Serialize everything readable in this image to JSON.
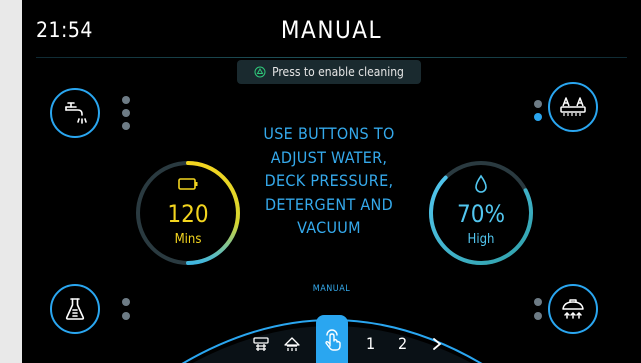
{
  "status": {
    "time": "21:54",
    "mode_title": "MANUAL"
  },
  "banner": {
    "text": "Press to enable cleaning",
    "icon": "recycle-icon"
  },
  "instructions": [
    "USE BUTTONS TO",
    "ADJUST WATER,",
    "DECK PRESSURE,",
    "DETERGENT AND",
    "VACUUM"
  ],
  "controls": {
    "water": {
      "icon": "faucet-icon",
      "level_dots": 3,
      "active_dots": 0
    },
    "deck_pressure": {
      "icon": "brush-deck-icon",
      "level_dots": 2,
      "active_dots": 1
    },
    "detergent": {
      "icon": "flask-icon",
      "level_dots": 2,
      "active_dots": 0
    },
    "vacuum": {
      "icon": "vacuum-icon",
      "level_dots": 2,
      "active_dots": 0
    }
  },
  "battery_gauge": {
    "icon": "battery-icon",
    "value": "120",
    "unit": "Mins"
  },
  "water_gauge": {
    "icon": "water-drop-icon",
    "value": "70%",
    "unit": "High",
    "level_fraction": 0.7
  },
  "mode_selector": {
    "label": "MANUAL",
    "items": [
      {
        "icon": "scrub-icon"
      },
      {
        "icon": "sweep-icon"
      },
      {
        "icon": "touch-icon",
        "selected": true
      },
      {
        "label": "1"
      },
      {
        "label": "2"
      },
      {
        "icon": "chevron-right-icon"
      }
    ]
  },
  "colors": {
    "accent": "#2aa6f0",
    "text_accent": "#35a9eb",
    "battery_ring_start": "#f3d51f",
    "battery_ring_end": "#3fb6e0",
    "water_ring_start": "#52c6ef",
    "water_ring_end": "#2fa0a8",
    "yellow_text": "#f3d51f"
  }
}
